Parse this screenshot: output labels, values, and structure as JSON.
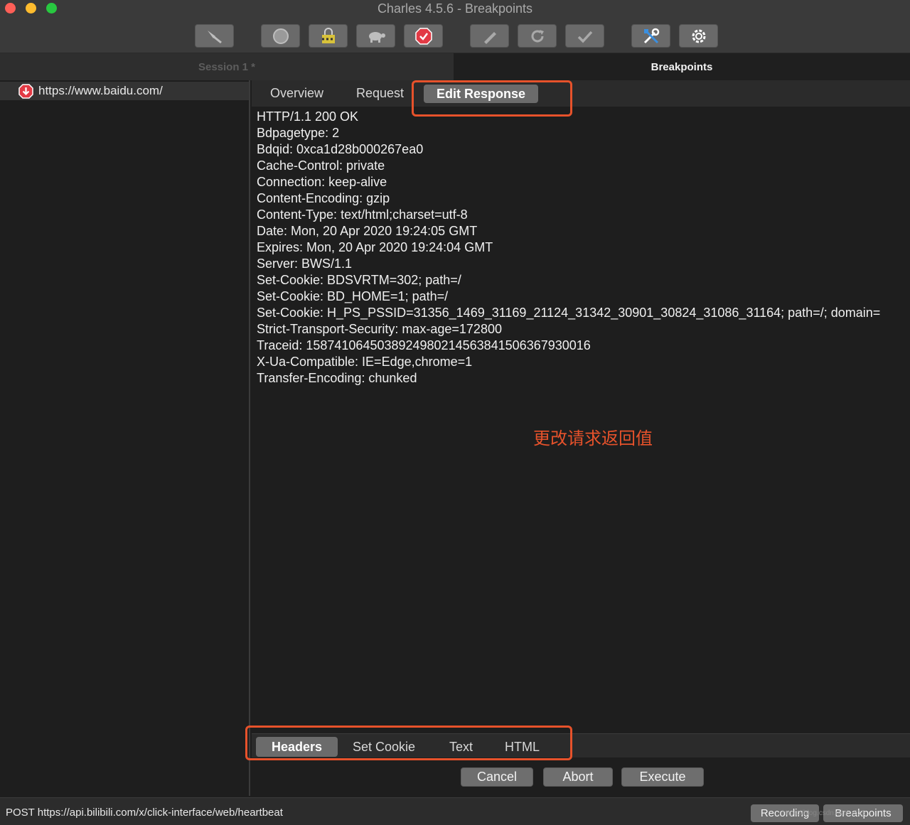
{
  "window": {
    "title": "Charles 4.5.6 - Breakpoints"
  },
  "toolbar": {
    "buttons": [
      {
        "icon": "broom-icon"
      },
      {
        "icon": "record-icon"
      },
      {
        "icon": "ssl-lock-icon"
      },
      {
        "icon": "turtle-throttle-icon"
      },
      {
        "icon": "breakpoint-stop-icon"
      },
      {
        "icon": "pen-compose-icon"
      },
      {
        "icon": "repeat-icon"
      },
      {
        "icon": "checkmark-validate-icon"
      },
      {
        "icon": "tools-icon"
      },
      {
        "icon": "settings-gear-icon"
      }
    ]
  },
  "tabs": {
    "session": "Session 1 *",
    "breakpoints": "Breakpoints"
  },
  "left_pane": {
    "request_url": "https://www.baidu.com/"
  },
  "subtabs": {
    "overview": "Overview",
    "request": "Request",
    "edit_response": "Edit Response"
  },
  "response_headers": [
    "HTTP/1.1 200 OK",
    "Bdpagetype: 2",
    "Bdqid: 0xca1d28b000267ea0",
    "Cache-Control: private",
    "Connection: keep-alive",
    "Content-Encoding: gzip",
    "Content-Type: text/html;charset=utf-8",
    "Date: Mon, 20 Apr 2020 19:24:05 GMT",
    "Expires: Mon, 20 Apr 2020 19:24:04 GMT",
    "Server: BWS/1.1",
    "Set-Cookie: BDSVRTM=302; path=/",
    "Set-Cookie: BD_HOME=1; path=/",
    "Set-Cookie: H_PS_PSSID=31356_1469_31169_21124_31342_30901_30824_31086_31164; path=/; domain=",
    "Strict-Transport-Security: max-age=172800",
    "Traceid: 1587410645038924980214563841506367930016",
    "X-Ua-Compatible: IE=Edge,chrome=1",
    "Transfer-Encoding: chunked"
  ],
  "annotation": "更改请求返回值",
  "bottom_tabs": {
    "headers": "Headers",
    "set_cookie": "Set Cookie",
    "text": "Text",
    "html": "HTML"
  },
  "actions": {
    "cancel": "Cancel",
    "abort": "Abort",
    "execute": "Execute"
  },
  "status": {
    "text": "POST https://api.bilibili.com/x/click-interface/web/heartbeat",
    "recording": "Recording",
    "breakpoints": "Breakpoints"
  },
  "watermark": "https://blog.csdn.net/...515",
  "colors": {
    "highlight": "#e7522b",
    "annotation": "#e7522b"
  }
}
